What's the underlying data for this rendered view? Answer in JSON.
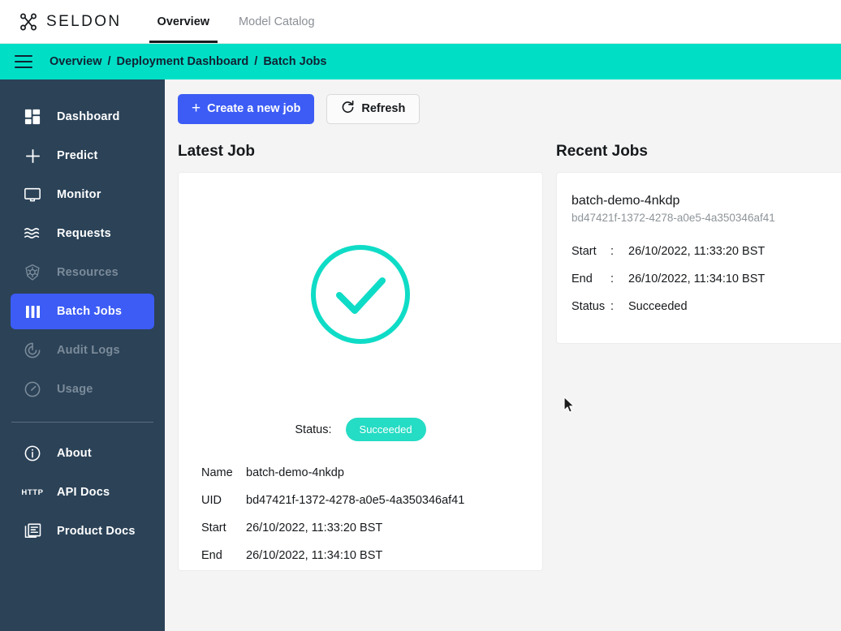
{
  "brand": {
    "name": "SELDON",
    "logo_icon": "seldon-knot-logo-icon"
  },
  "topnav": {
    "items": [
      {
        "label": "Overview",
        "active": true
      },
      {
        "label": "Model Catalog",
        "active": false
      }
    ]
  },
  "breadcrumb": {
    "menu_icon": "hamburger-menu-icon",
    "separator": "/",
    "items": [
      {
        "label": "Overview"
      },
      {
        "label": "Deployment Dashboard"
      },
      {
        "label": "Batch Jobs"
      }
    ]
  },
  "sidebar": {
    "items": [
      {
        "label": "Dashboard",
        "icon": "grid-dashboard-icon",
        "state": "normal"
      },
      {
        "label": "Predict",
        "icon": "plus-icon",
        "state": "normal"
      },
      {
        "label": "Monitor",
        "icon": "monitor-screen-icon",
        "state": "normal"
      },
      {
        "label": "Requests",
        "icon": "waves-icon",
        "state": "normal"
      },
      {
        "label": "Resources",
        "icon": "kubernetes-helm-icon",
        "state": "disabled"
      },
      {
        "label": "Batch Jobs",
        "icon": "bars-batch-icon",
        "state": "active"
      },
      {
        "label": "Audit Logs",
        "icon": "radar-spiral-icon",
        "state": "disabled"
      },
      {
        "label": "Usage",
        "icon": "gauge-speedometer-icon",
        "state": "disabled"
      }
    ],
    "footer_items": [
      {
        "label": "About",
        "icon": "info-circle-icon"
      },
      {
        "label": "API Docs",
        "icon": "http-badge-icon",
        "badge_text": "HTTP"
      },
      {
        "label": "Product Docs",
        "icon": "documents-stack-icon"
      }
    ]
  },
  "toolbar": {
    "create_label": "Create a new job",
    "create_icon": "plus-icon",
    "refresh_label": "Refresh",
    "refresh_icon": "refresh-circular-arrow-icon"
  },
  "latest_job": {
    "section_title": "Latest Job",
    "status_icon": "success-check-circle-icon",
    "status_label": "Status:",
    "status_value": "Succeeded",
    "fields": [
      {
        "key": "Name",
        "value": "batch-demo-4nkdp"
      },
      {
        "key": "UID",
        "value": "bd47421f-1372-4278-a0e5-4a350346af41"
      },
      {
        "key": "Start",
        "value": "26/10/2022, 11:33:20 BST"
      },
      {
        "key": "End",
        "value": "26/10/2022, 11:34:10 BST"
      }
    ]
  },
  "recent_jobs": {
    "section_title": "Recent Jobs",
    "jobs": [
      {
        "name": "batch-demo-4nkdp",
        "uid": "bd47421f-1372-4278-a0e5-4a350346af41",
        "rows": [
          {
            "key": "Start",
            "colon": ":",
            "value": "26/10/2022, 11:33:20 BST"
          },
          {
            "key": "End",
            "colon": ":",
            "value": "26/10/2022, 11:34:10 BST"
          },
          {
            "key": "Status",
            "colon": ":",
            "value": "Succeeded"
          }
        ]
      }
    ]
  },
  "colors": {
    "brand_teal": "#00dfc6",
    "accent_blue": "#3c5cf5",
    "sidebar_bg": "#2b4257",
    "success_teal": "#25dcc4",
    "page_bg": "#f4f4f4"
  }
}
